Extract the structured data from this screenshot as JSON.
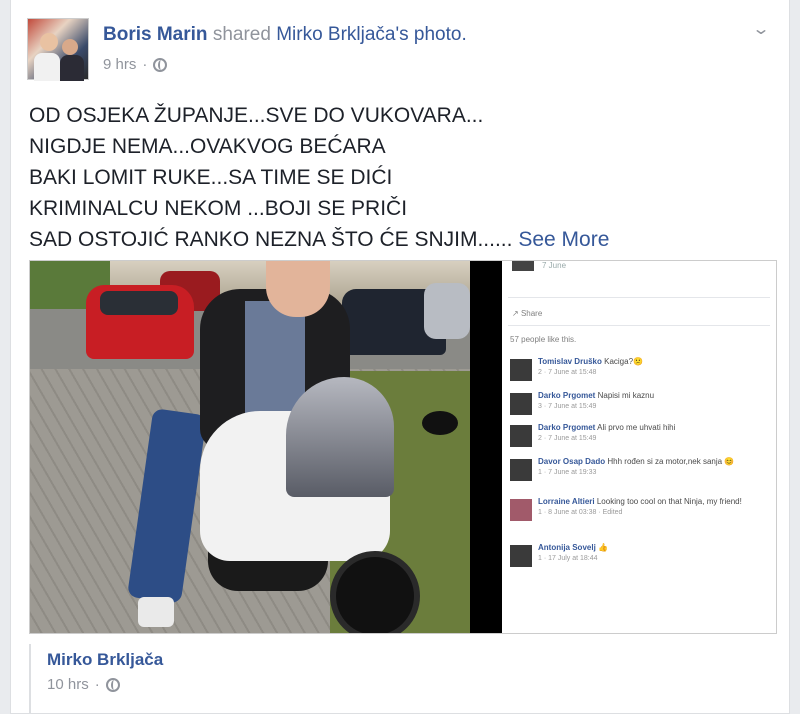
{
  "post": {
    "author": "Boris Marin",
    "action": "shared",
    "original_owner": "Mirko Brkljača's photo.",
    "time": "9 hrs",
    "privacy_icon": "globe-icon",
    "menu_icon": "chevron-down-icon",
    "lines": [
      "OD OSJEKA ŽUPANJE...SVE DO VUKOVARA...",
      "NIGDJE NEMA...OVAKVOG BEĆARA",
      "BAKI LOMIT RUKE...SA TIME SE DIĆI",
      "KRIMINALCU NEKOM ...BOJI SE PRIČI",
      "SAD OSTOJIĆ RANKO NEZNA ŠTO ĆE SNJIM......"
    ],
    "see_more": "See More"
  },
  "photo_comments": {
    "top_time": "7 June",
    "share_label": "Share",
    "likes_label": "57 people like this.",
    "comments": [
      {
        "name": "Tomislav Druško",
        "text": "Kaciga?😕",
        "meta": "2 · 7 June at 15:48"
      },
      {
        "name": "Darko Prgomet",
        "text": "Napisi mi kaznu",
        "meta": "3 · 7 June at 15:49"
      },
      {
        "name": "Darko Prgomet",
        "text": "Ali prvo me uhvati hihi",
        "meta": "2 · 7 June at 15:49"
      },
      {
        "name": "Davor Osap Dado",
        "text": "Hhh rođen si za motor,nek sanja 😊",
        "meta": "1 · 7 June at 19:33"
      },
      {
        "name": "Lorraine Altieri",
        "text": "Looking too cool on that Ninja, my friend!",
        "meta": "1 · 8 June at 03:38 · Edited"
      },
      {
        "name": "Antonija Sovelj",
        "text": "👍",
        "meta": "1 · 17 July at 18:44"
      }
    ]
  },
  "shared_from": {
    "name": "Mirko Brkljača",
    "time": "10 hrs",
    "privacy_icon": "globe-icon"
  },
  "colors": {
    "link": "#365899",
    "muted": "#90949c",
    "text": "#1d2129",
    "background": "#e9ebee"
  }
}
